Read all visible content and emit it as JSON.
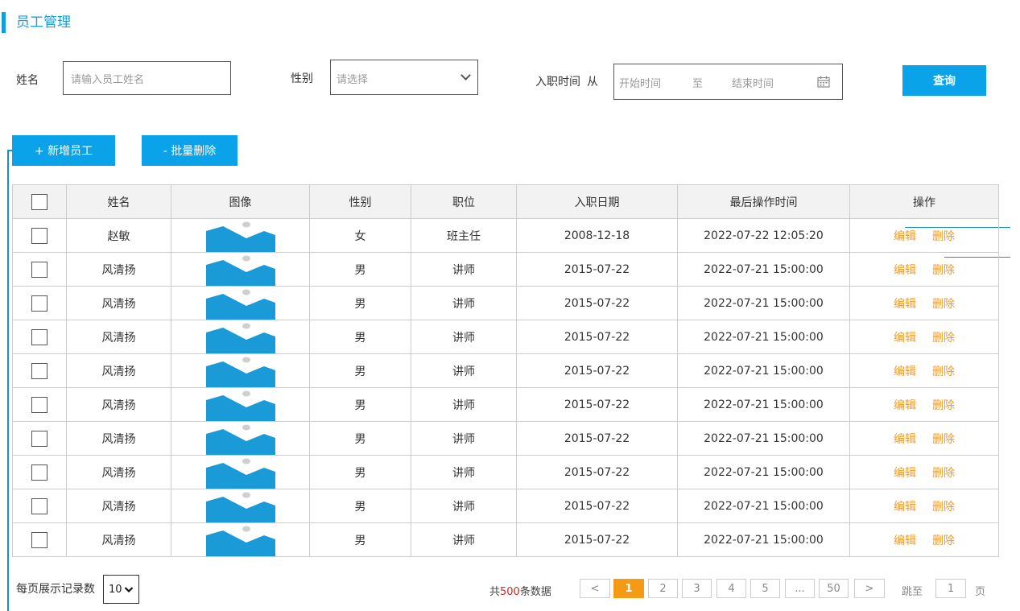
{
  "page": {
    "title": "员工管理"
  },
  "search": {
    "name_label": "姓名",
    "name_placeholder": "请输入员工姓名",
    "gender_label": "性别",
    "gender_placeholder": "请选择",
    "date_label": "入职时间",
    "date_from_label": "从",
    "date_start_placeholder": "开始时间",
    "date_to": "至",
    "date_end_placeholder": "结束时间",
    "query_button": "查询"
  },
  "toolbar": {
    "add_button": "+ 新增员工",
    "batch_delete_button": "- 批量删除"
  },
  "table": {
    "headers": [
      "",
      "姓名",
      "图像",
      "性别",
      "职位",
      "入职日期",
      "最后操作时间",
      "操作"
    ],
    "edit_label": "编辑",
    "delete_label": "删除",
    "rows": [
      {
        "name": "赵敏",
        "gender": "女",
        "position": "班主任",
        "hire_date": "2008-12-18",
        "last_op": "2022-07-22 12:05:20"
      },
      {
        "name": "风清扬",
        "gender": "男",
        "position": "讲师",
        "hire_date": "2015-07-22",
        "last_op": "2022-07-21 15:00:00"
      },
      {
        "name": "风清扬",
        "gender": "男",
        "position": "讲师",
        "hire_date": "2015-07-22",
        "last_op": "2022-07-21 15:00:00"
      },
      {
        "name": "风清扬",
        "gender": "男",
        "position": "讲师",
        "hire_date": "2015-07-22",
        "last_op": "2022-07-21 15:00:00"
      },
      {
        "name": "风清扬",
        "gender": "男",
        "position": "讲师",
        "hire_date": "2015-07-22",
        "last_op": "2022-07-21 15:00:00"
      },
      {
        "name": "风清扬",
        "gender": "男",
        "position": "讲师",
        "hire_date": "2015-07-22",
        "last_op": "2022-07-21 15:00:00"
      },
      {
        "name": "风清扬",
        "gender": "男",
        "position": "讲师",
        "hire_date": "2015-07-22",
        "last_op": "2022-07-21 15:00:00"
      },
      {
        "name": "风清扬",
        "gender": "男",
        "position": "讲师",
        "hire_date": "2015-07-22",
        "last_op": "2022-07-21 15:00:00"
      },
      {
        "name": "风清扬",
        "gender": "男",
        "position": "讲师",
        "hire_date": "2015-07-22",
        "last_op": "2022-07-21 15:00:00"
      },
      {
        "name": "风清扬",
        "gender": "男",
        "position": "讲师",
        "hire_date": "2015-07-22",
        "last_op": "2022-07-21 15:00:00"
      }
    ]
  },
  "pagination": {
    "page_size_label": "每页展示记录数",
    "page_size_value": "10",
    "total_prefix": "共",
    "total_count": "500",
    "total_suffix": "条数据",
    "prev": "<",
    "next": ">",
    "pages": [
      "1",
      "2",
      "3",
      "4",
      "5",
      "...",
      "50"
    ],
    "current_page": "1",
    "jump_label": "跳至",
    "jump_value": "1",
    "page_unit": "页"
  },
  "colors": {
    "accent": "#0aa3ea",
    "action": "#f59a23",
    "total_highlight": "#e02020",
    "image_fill": "#1a9ad6"
  },
  "icons": {
    "gender_select": "chevron-down-icon",
    "date_picker": "calendar-icon",
    "row_image": "landscape-image-icon"
  }
}
